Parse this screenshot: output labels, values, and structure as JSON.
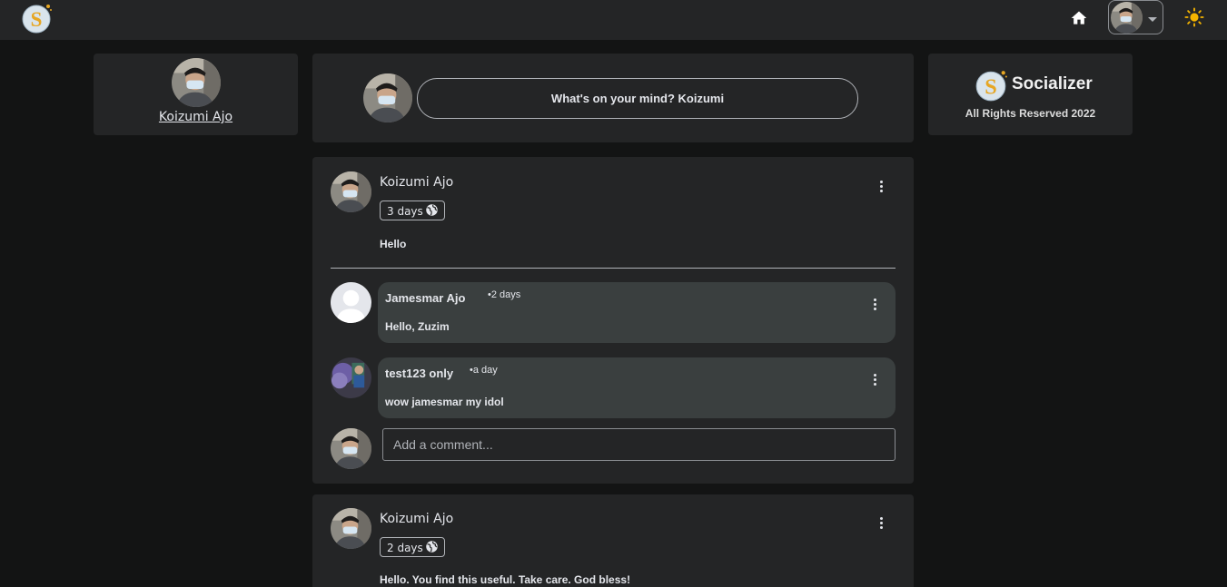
{
  "brand": {
    "name": "Socializer",
    "footer": "All Rights Reserved 2022"
  },
  "current_user": {
    "name": "Koizumi Ajo"
  },
  "composer": {
    "prompt": "What's on your mind? Koizumi"
  },
  "posts": [
    {
      "author": "Koizumi Ajo",
      "time": "3 days",
      "privacy_icon": "globe-icon",
      "body": "Hello",
      "comments": [
        {
          "author": "Jamesmar Ajo",
          "time": "•2 days",
          "text": "Hello, Zuzim"
        },
        {
          "author": "test123 only",
          "time": "•a day",
          "text": "wow jamesmar my idol"
        }
      ],
      "comment_placeholder": "Add a comment..."
    },
    {
      "author": "Koizumi Ajo",
      "time": "2 days",
      "privacy_icon": "globe-icon",
      "body": "Hello. You find this useful. Take care. God bless!"
    }
  ],
  "colors": {
    "background": "#131414",
    "card": "#242526",
    "comment_bubble": "#3a3f3f",
    "accent_sun": "#f5b400",
    "logo_gold": "#e6a623"
  }
}
